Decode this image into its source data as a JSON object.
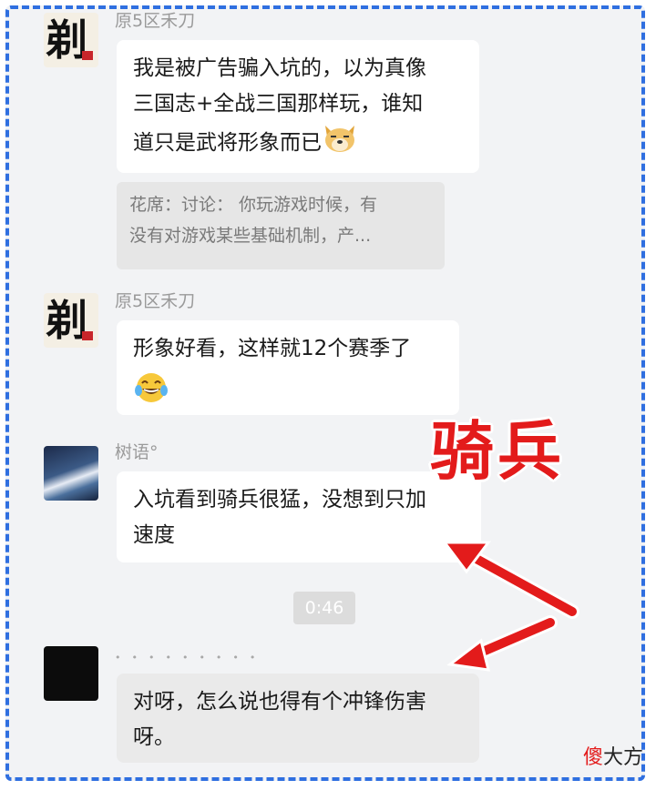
{
  "messages": [
    {
      "sender": "原5区禾刀",
      "text_lines": [
        "我是被广告骗入坑的，以为真像",
        "三国志+全战三国那样玩，谁知",
        "道只是武将形象而已"
      ],
      "emoji": "doge-emoji",
      "quote_lines": [
        "花席：讨论： 你玩游戏时候，有",
        "没有对游戏某些基础机制，产..."
      ]
    },
    {
      "sender": "原5区禾刀",
      "text_lines": [
        "形象好看，这样就12个赛季了"
      ],
      "emoji": "tears-of-joy-emoji"
    },
    {
      "sender": "树语°",
      "text_lines": [
        "入坑看到骑兵很猛，没想到只加",
        "速度"
      ]
    },
    {
      "sender": "",
      "text_lines": [
        "对呀，怎么说也得有个冲锋伤害",
        "呀。"
      ]
    }
  ],
  "timestamp": "0:46",
  "overlay_word": "骑兵",
  "watermark": {
    "red": "傻",
    "black": "大方"
  },
  "colors": {
    "frame": "#2f6fe0",
    "overlay": "#e31b1b",
    "bubble": "#ffffff",
    "background": "#f2f3f5"
  }
}
